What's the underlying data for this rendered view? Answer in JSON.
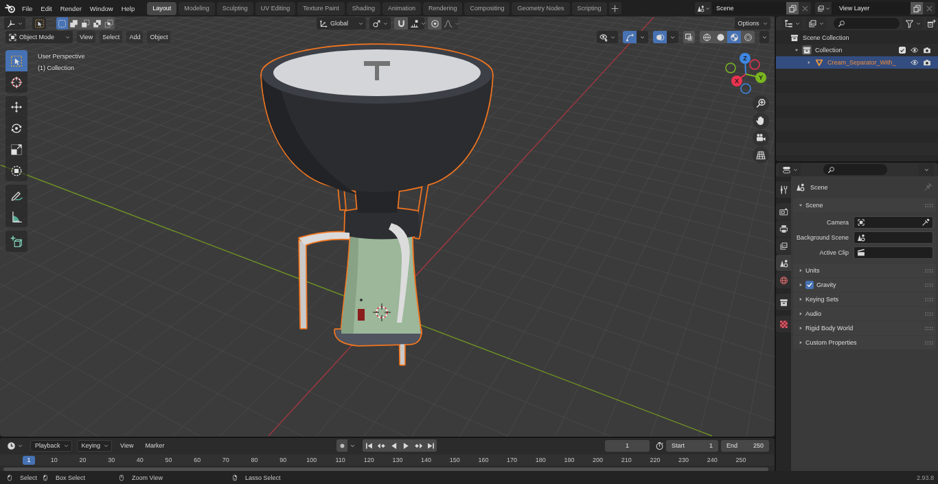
{
  "top_bar": {
    "menus": [
      "File",
      "Edit",
      "Render",
      "Window",
      "Help"
    ],
    "workspace_tabs": [
      {
        "label": "Layout",
        "selected": true
      },
      {
        "label": "Modeling",
        "selected": false
      },
      {
        "label": "Sculpting",
        "selected": false
      },
      {
        "label": "UV Editing",
        "selected": false
      },
      {
        "label": "Texture Paint",
        "selected": false
      },
      {
        "label": "Shading",
        "selected": false
      },
      {
        "label": "Animation",
        "selected": false
      },
      {
        "label": "Rendering",
        "selected": false
      },
      {
        "label": "Compositing",
        "selected": false
      },
      {
        "label": "Geometry Nodes",
        "selected": false
      },
      {
        "label": "Scripting",
        "selected": false
      }
    ],
    "scene": "Scene",
    "view_layer": "View Layer"
  },
  "viewport": {
    "tool_header": {
      "select_modes": [
        {
          "kind": "set",
          "selected": true
        },
        {
          "kind": "extend",
          "selected": false
        },
        {
          "kind": "subtract",
          "selected": false
        },
        {
          "kind": "difference",
          "selected": false
        },
        {
          "kind": "intersect",
          "selected": false
        }
      ],
      "orientation": "Global",
      "snap": {
        "on": false
      },
      "proportional_editing": {
        "on": false
      },
      "options": "Options"
    },
    "header": {
      "mode": "Object Mode",
      "menus": [
        "View",
        "Select",
        "Add",
        "Object"
      ],
      "gizmos": {
        "on": true
      },
      "overlays": {
        "on": true
      },
      "xray": {
        "on": false
      },
      "shading": [
        {
          "kind": "wireframe",
          "selected": false
        },
        {
          "kind": "solid",
          "selected": false
        },
        {
          "kind": "material",
          "selected": true
        },
        {
          "kind": "rendered",
          "selected": false
        }
      ]
    },
    "tool_groups": [
      [
        {
          "kind": "select_box",
          "selected": true
        },
        {
          "kind": "cursor",
          "selected": false
        }
      ],
      [
        {
          "kind": "move",
          "selected": false
        },
        {
          "kind": "rotate",
          "selected": false
        },
        {
          "kind": "scale",
          "selected": false
        },
        {
          "kind": "transform",
          "selected": false
        }
      ],
      [
        {
          "kind": "annotate",
          "selected": false
        },
        {
          "kind": "measure",
          "selected": false
        }
      ],
      [
        {
          "kind": "add_cube",
          "selected": false
        }
      ]
    ],
    "view_name": "User Perspective",
    "collection_info": "(1) Collection",
    "gizmo_axes": [
      {
        "label": "Z",
        "color": "#3d87e3"
      },
      {
        "label": "Y",
        "color": "#7ab51f"
      },
      {
        "label": "X",
        "color": "#ea3350"
      }
    ]
  },
  "timeline": {
    "menus": [
      {
        "label": "Playback",
        "kind": "dropdown"
      },
      {
        "label": "Keying",
        "kind": "dropdown"
      },
      {
        "label": "View",
        "kind": "menu"
      },
      {
        "label": "Marker",
        "kind": "menu"
      }
    ],
    "auto_keying": {
      "on": false
    },
    "current_frame": "1",
    "start": {
      "label": "Start",
      "value": "1"
    },
    "end": {
      "label": "End",
      "value": "250"
    },
    "ruler": {
      "current": "1",
      "ticks": [
        "10",
        "20",
        "30",
        "40",
        "50",
        "60",
        "70",
        "80",
        "90",
        "100",
        "110",
        "120",
        "130",
        "140",
        "150",
        "160",
        "170",
        "180",
        "190",
        "200",
        "210",
        "220",
        "230",
        "240",
        "250"
      ]
    }
  },
  "outliner": {
    "items": [
      {
        "label": "Scene Collection",
        "kind": "scene_collection",
        "selected": false,
        "active": false,
        "children": [
          {
            "label": "Collection",
            "kind": "collection",
            "selected": false,
            "active": true,
            "expanded": true,
            "checked": true,
            "visible": true,
            "renderable": true,
            "children": [
              {
                "label": "Cream_Separator_With_",
                "kind": "mesh",
                "selected": true,
                "active": false,
                "expanded": false,
                "visible": true,
                "renderable": true
              }
            ]
          }
        ]
      }
    ]
  },
  "properties": {
    "tab_groups": [
      [
        {
          "kind": "tool",
          "selected": false
        }
      ],
      [
        {
          "kind": "render",
          "selected": false
        },
        {
          "kind": "output",
          "selected": false
        },
        {
          "kind": "view_layer",
          "selected": false
        },
        {
          "kind": "scene",
          "selected": true
        },
        {
          "kind": "world",
          "selected": false
        }
      ],
      [
        {
          "kind": "collection",
          "selected": false
        }
      ],
      [
        {
          "kind": "texture",
          "selected": false
        }
      ]
    ],
    "context": "Scene",
    "panels": [
      {
        "title": "Scene",
        "kind": "plain",
        "expanded": true,
        "fields": [
          {
            "label": "Camera",
            "kind": "camera"
          },
          {
            "label": "Background Scene",
            "kind": "scene"
          },
          {
            "label": "Active Clip",
            "kind": "clip"
          }
        ]
      },
      {
        "title": "Units",
        "kind": "plain",
        "expanded": false
      },
      {
        "title": "Gravity",
        "kind": "toggle",
        "checked": true,
        "expanded": false
      },
      {
        "title": "Keying Sets",
        "kind": "plain",
        "expanded": false
      },
      {
        "title": "Audio",
        "kind": "plain",
        "expanded": false
      },
      {
        "title": "Rigid Body World",
        "kind": "plain",
        "expanded": false
      },
      {
        "title": "Custom Properties",
        "kind": "plain",
        "expanded": false
      }
    ]
  },
  "status_bar": {
    "hints": [
      {
        "label": "Select",
        "kind": "left_click"
      },
      {
        "label": "Box Select",
        "kind": "left_drag"
      },
      {
        "label": "Zoom View",
        "kind": "middle_click"
      },
      {
        "label": "Lasso Select",
        "kind": "right_drag"
      }
    ],
    "version": "2.93.8"
  }
}
